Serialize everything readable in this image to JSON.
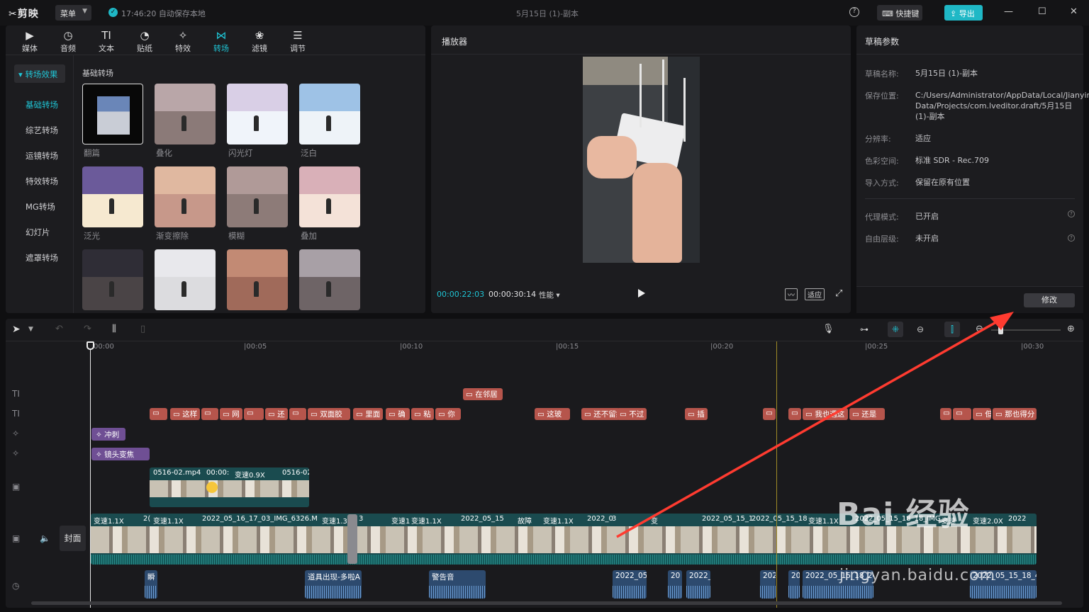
{
  "app": {
    "name": "剪映",
    "menu_label": "菜单",
    "save_status": "17:46:20 自动保存本地",
    "window_title": "5月15日 (1)-副本",
    "shortcut_label": "快捷键",
    "export_label": "导出",
    "accent": "#1fc4d4"
  },
  "media_tabs": [
    {
      "label": "媒体",
      "icon": "media-icon"
    },
    {
      "label": "音频",
      "icon": "audio-icon"
    },
    {
      "label": "文本",
      "icon": "text-icon"
    },
    {
      "label": "贴纸",
      "icon": "sticker-icon"
    },
    {
      "label": "特效",
      "icon": "effect-icon"
    },
    {
      "label": "转场",
      "icon": "transition-icon"
    },
    {
      "label": "滤镜",
      "icon": "filter-icon"
    },
    {
      "label": "调节",
      "icon": "adjust-icon"
    }
  ],
  "sidebar": {
    "header": "转场效果",
    "items": [
      "基础转场",
      "综艺转场",
      "运镜转场",
      "特效转场",
      "MG转场",
      "幻灯片",
      "遮罩转场"
    ]
  },
  "section_title": "基础转场",
  "transitions": [
    "翻篇",
    "叠化",
    "闪光灯",
    "泛白",
    "泛光",
    "渐变擦除",
    "模糊",
    "叠加",
    "",
    "",
    "",
    ""
  ],
  "player": {
    "title": "播放器",
    "current_time": "00:00:22:03",
    "total_time": "00:00:30:14",
    "perf_label": "性能",
    "fit_label": "适应"
  },
  "draft": {
    "title": "草稿参数",
    "rows": [
      {
        "k": "草稿名称:",
        "v": "5月15日 (1)-副本"
      },
      {
        "k": "保存位置:",
        "v": "C:/Users/Administrator/AppData/Local/JianyingPro/User Data/Projects/com.lveditor.draft/5月15日 (1)-副本"
      },
      {
        "k": "分辨率:",
        "v": "适应"
      },
      {
        "k": "色彩空间:",
        "v": "标准 SDR - Rec.709"
      },
      {
        "k": "导入方式:",
        "v": "保留在原有位置"
      },
      {
        "k": "代理模式:",
        "v": "已开启"
      },
      {
        "k": "自由层级:",
        "v": "未开启"
      }
    ],
    "modify_label": "修改"
  },
  "timeline": {
    "ticks": [
      "00:00",
      "|00:05",
      "|00:10",
      "|00:15",
      "|00:20",
      "|00:25",
      "|00:30"
    ],
    "text_track1": [
      "在邻居"
    ],
    "text_track2": [
      "",
      "这样",
      "",
      "网",
      "",
      "还",
      "",
      "双面胶",
      "里面",
      "确",
      "粘",
      "你",
      "这玻",
      "还不留痕",
      "不过",
      "插",
      "",
      "",
      "我也遇这",
      "还是",
      "",
      "",
      "但",
      "那也得分"
    ],
    "fx_track1": "冲刺",
    "fx_track2": "镜头变焦",
    "overlay_clips": [
      "0516-02.mp4",
      "00:00:",
      "变速0.9X",
      "0516-02"
    ],
    "main_clips": [
      "变速1.1X",
      "2(",
      "变速1.1X",
      "2022_05_16_17_03_IMG_6326.M",
      "变速1.3",
      "3",
      "变速1",
      "变速1.1X",
      "2022_05_15",
      "故障",
      "变速1.1X",
      "2022_0",
      "3",
      "变",
      "2022_05_15_1",
      "2022_05_15_18",
      "变速1.1X",
      "2022_05_15_18_18_IMG_",
      "变速",
      "变速2.0X",
      "2022"
    ],
    "cover_label": "封面",
    "audio_clips": [
      "瞬",
      "道具出现-多啦A",
      "警告音",
      "2022_05",
      "20",
      "2022_",
      "202",
      "20",
      "2022_05_15_18_24_IMG_",
      "2022_05_15_18_44"
    ]
  },
  "watermark": {
    "line1": "Bai 经验",
    "line2": "jingyan.baidu.com"
  }
}
